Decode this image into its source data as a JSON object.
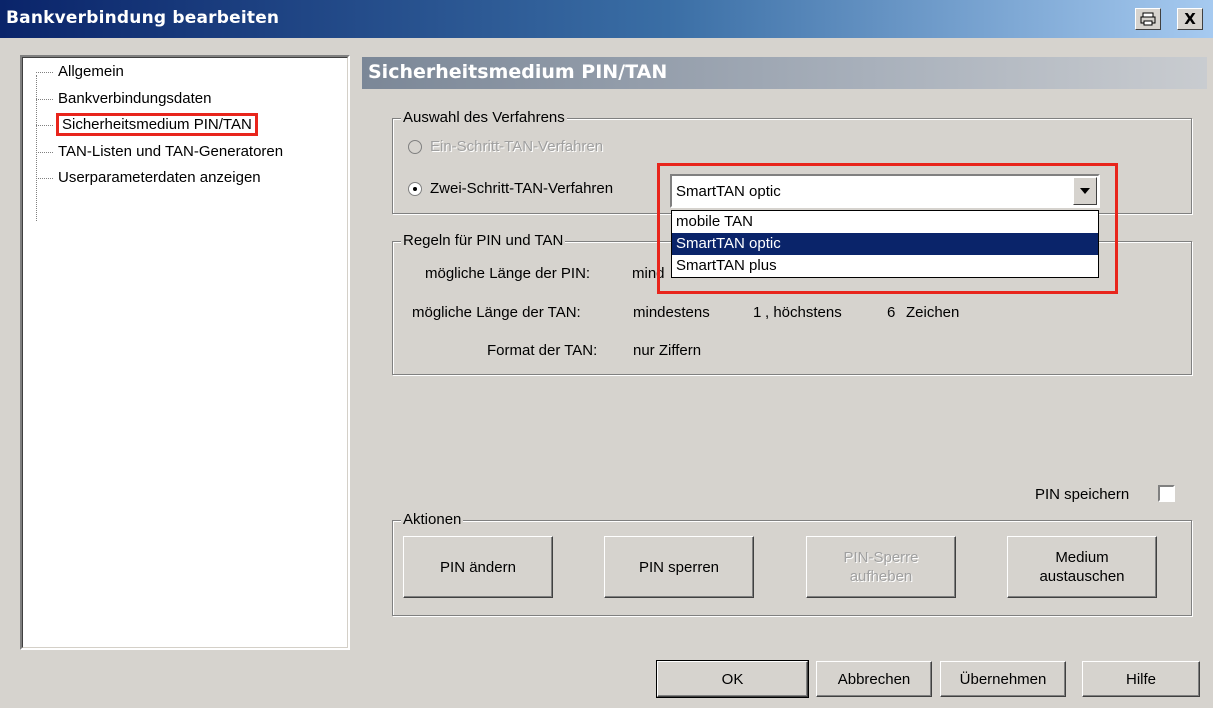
{
  "window": {
    "title": "Bankverbindung bearbeiten",
    "print_icon": "printer-icon",
    "close_label": "X"
  },
  "tree": {
    "items": [
      {
        "label": "Allgemein"
      },
      {
        "label": "Bankverbindungsdaten"
      },
      {
        "label": "Sicherheitsmedium PIN/TAN",
        "selected": true
      },
      {
        "label": "TAN-Listen und TAN-Generatoren"
      },
      {
        "label": "Userparameterdaten anzeigen"
      }
    ]
  },
  "section": {
    "title": "Sicherheitsmedium PIN/TAN"
  },
  "verfahren": {
    "legend": "Auswahl des Verfahrens",
    "option1": "Ein-Schritt-TAN-Verfahren",
    "option2": "Zwei-Schritt-TAN-Verfahren",
    "selected_value": "SmartTAN optic",
    "options": [
      "mobile TAN",
      "SmartTAN optic",
      "SmartTAN plus"
    ],
    "highlighted_option": "SmartTAN optic"
  },
  "regeln": {
    "legend": "Regeln für PIN und TAN",
    "pin_label": "mögliche Länge der PIN:",
    "pin_value": "mind",
    "tan_label": "mögliche Länge der TAN:",
    "tan_min_word": "mindestens",
    "tan_min": "1",
    "tan_max_word": ", höchstens",
    "tan_max": "6",
    "tan_unit": "Zeichen",
    "format_label": "Format der TAN:",
    "format_value": "nur Ziffern"
  },
  "pin_speichern": {
    "label": "PIN speichern",
    "checked": false
  },
  "aktionen": {
    "legend": "Aktionen",
    "btn_pin_aendern": "PIN ändern",
    "btn_pin_sperren": "PIN sperren",
    "btn_sperre_aufheben": "PIN-Sperre aufheben",
    "btn_medium_austauschen": "Medium austauschen"
  },
  "footer": {
    "ok": "OK",
    "abbrechen": "Abbrechen",
    "uebernehmen": "Übernehmen",
    "hilfe": "Hilfe"
  }
}
